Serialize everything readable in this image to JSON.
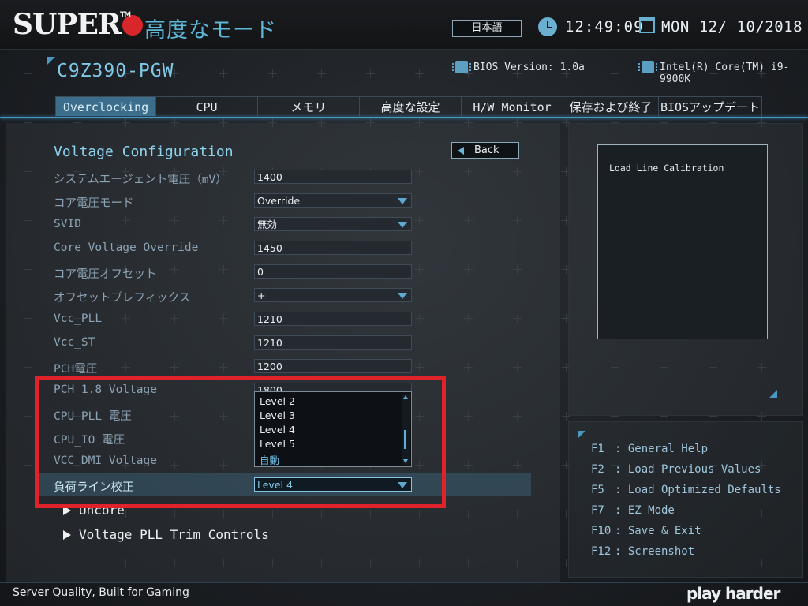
{
  "header": {
    "brand": "SUPER",
    "mode_title": "高度なモード",
    "language": "日本語",
    "time": "12:49:09",
    "date": "MON  12/ 10/2018",
    "model": "C9Z390-PGW",
    "bios_version": "BIOS Version: 1.0a",
    "cpu": "Intel(R) Core(TM) i9-9900K"
  },
  "tabs": [
    {
      "label": "Overclocking",
      "active": true
    },
    {
      "label": "CPU"
    },
    {
      "label": "メモリ"
    },
    {
      "label": "高度な設定"
    },
    {
      "label": "H/W Monitor"
    },
    {
      "label": "保存および終了"
    },
    {
      "label": "BIOSアップデート"
    }
  ],
  "section": {
    "title": "Voltage Configuration",
    "back_label": "Back"
  },
  "settings": [
    {
      "label": "システムエージェント電圧（mV）",
      "value": "1400",
      "type": "input"
    },
    {
      "label": "コア電圧モード",
      "value": "Override",
      "type": "select"
    },
    {
      "label": "SVID",
      "value": "無効",
      "type": "select"
    },
    {
      "label": "Core Voltage Override",
      "value": "1450",
      "type": "input"
    },
    {
      "label": "コア電圧オフセット",
      "value": "0",
      "type": "input"
    },
    {
      "label": "オフセットプレフィックス",
      "value": "+",
      "type": "select"
    },
    {
      "label": "Vcc_PLL",
      "value": "1210",
      "type": "input"
    },
    {
      "label": "Vcc_ST",
      "value": "1210",
      "type": "input"
    },
    {
      "label": "PCH電圧",
      "value": "1200",
      "type": "input"
    },
    {
      "label": "PCH 1.8 Voltage",
      "value": "1800",
      "type": "input"
    },
    {
      "label": "CPU PLL 電圧",
      "value": "",
      "type": "input"
    },
    {
      "label": "CPU_IO 電圧",
      "value": "",
      "type": "input"
    },
    {
      "label": "VCC DMI Voltage",
      "value": "",
      "type": "input"
    },
    {
      "label": "負荷ライン校正",
      "value": "Level 4",
      "type": "select",
      "selected": true
    }
  ],
  "dropdown": {
    "options": [
      "Level 2",
      "Level 3",
      "Level 4",
      "Level 5",
      "自動"
    ]
  },
  "submenus": [
    {
      "label": "Uncore"
    },
    {
      "label": "Voltage PLL Trim Controls"
    }
  ],
  "help": {
    "text": "Load Line Calibration"
  },
  "keys": [
    {
      "key": "F1",
      "desc": ": General Help"
    },
    {
      "key": "F2",
      "desc": ": Load Previous Values"
    },
    {
      "key": "F5",
      "desc": ": Load Optimized Defaults"
    },
    {
      "key": "F7",
      "desc": ": EZ Mode"
    },
    {
      "key": "F10",
      "desc": ": Save & Exit"
    },
    {
      "key": "F12",
      "desc": ": Screenshot"
    }
  ],
  "footer": {
    "tagline": "Server Quality, Built for Gaming",
    "slogan": "play harder"
  },
  "colors": {
    "accent": "#4a98c2",
    "highlight_box": "#e0222b",
    "active_tab": "#3c6d8a"
  }
}
